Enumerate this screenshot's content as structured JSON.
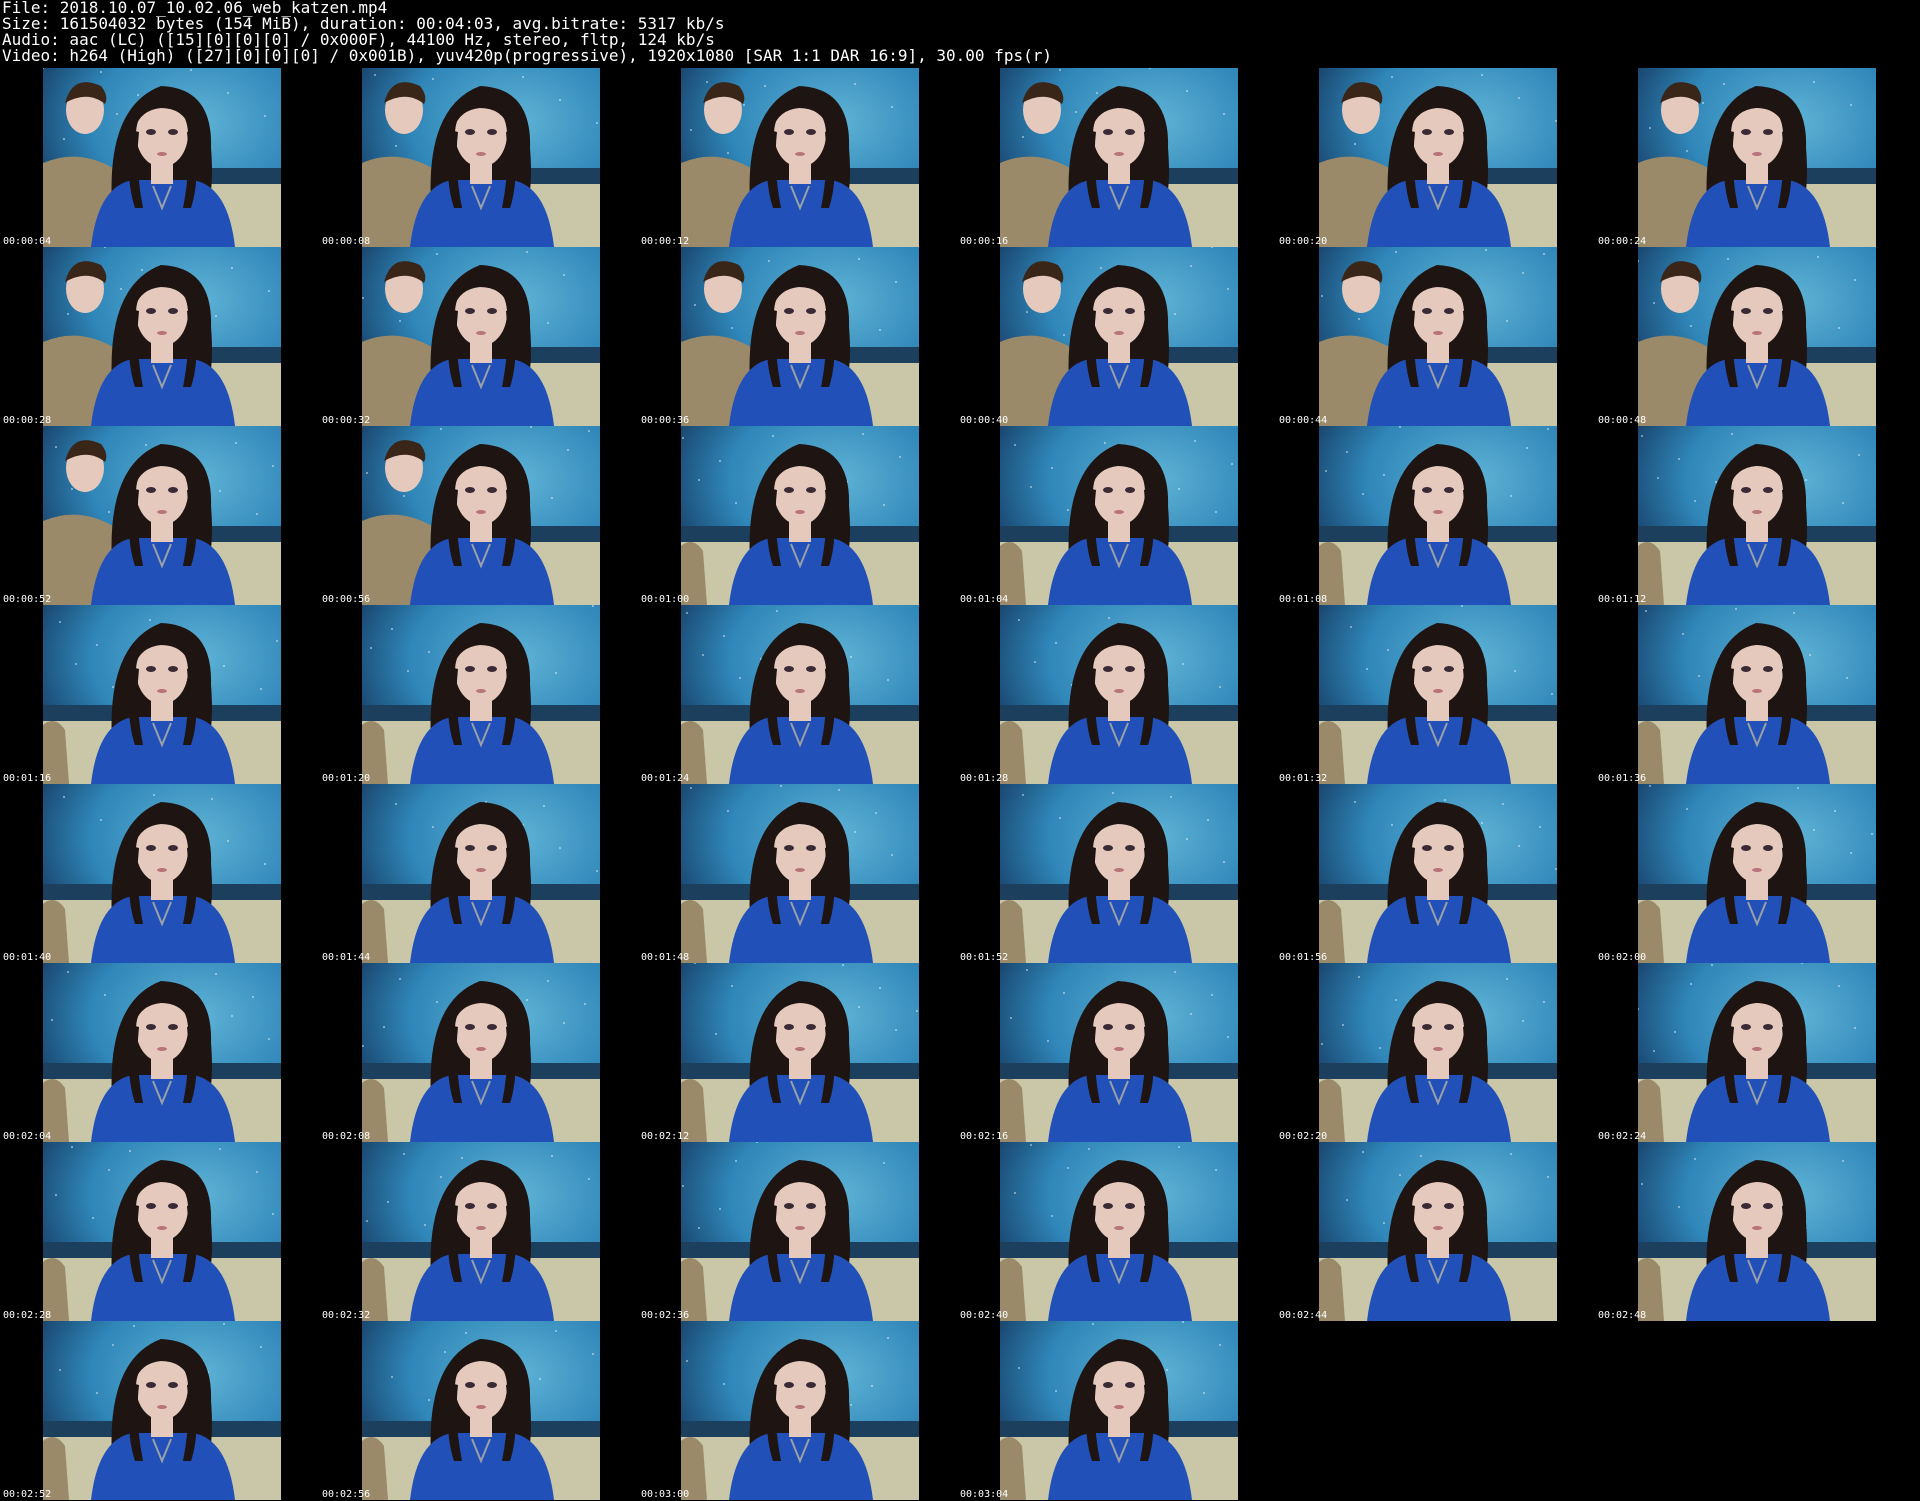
{
  "header": {
    "file_line": "File: 2018.10.07_10.02.06_web_katzen.mp4",
    "size_line": "Size: 161504032 bytes (154 MiB), duration: 00:04:03, avg.bitrate: 5317 kb/s",
    "audio_line": "Audio: aac (LC) ([15][0][0][0] / 0x000F), 44100 Hz, stereo, fltp, 124 kb/s",
    "video_line": "Video: h264 (High) ([27][0][0][0] / 0x001B), yuv420p(progressive), 1920x1080 [SAR 1:1 DAR 16:9], 30.00 fps(r)"
  },
  "colors": {
    "background": "#000000",
    "text": "#ffffff",
    "thumb_sky": "#2f86b8",
    "thumb_sky_light": "#5fb3d6",
    "shirt": "#2050b8",
    "hair": "#1e1412",
    "skin": "#e6c9bd",
    "sofa": "#c9c7a8",
    "hoodie": "#9a8a6a"
  },
  "thumbnails": [
    {
      "time": "00:00:04",
      "companion": true
    },
    {
      "time": "00:00:08",
      "companion": true
    },
    {
      "time": "00:00:12",
      "companion": true
    },
    {
      "time": "00:00:16",
      "companion": true
    },
    {
      "time": "00:00:20",
      "companion": true
    },
    {
      "time": "00:00:24",
      "companion": true
    },
    {
      "time": "00:00:28",
      "companion": true
    },
    {
      "time": "00:00:32",
      "companion": true
    },
    {
      "time": "00:00:36",
      "companion": true
    },
    {
      "time": "00:00:40",
      "companion": true
    },
    {
      "time": "00:00:44",
      "companion": true
    },
    {
      "time": "00:00:48",
      "companion": true
    },
    {
      "time": "00:00:52",
      "companion": true
    },
    {
      "time": "00:00:56",
      "companion": true
    },
    {
      "time": "00:01:00",
      "companion": false
    },
    {
      "time": "00:01:04",
      "companion": false
    },
    {
      "time": "00:01:08",
      "companion": false
    },
    {
      "time": "00:01:12",
      "companion": false
    },
    {
      "time": "00:01:16",
      "companion": false
    },
    {
      "time": "00:01:20",
      "companion": false
    },
    {
      "time": "00:01:24",
      "companion": false
    },
    {
      "time": "00:01:28",
      "companion": false
    },
    {
      "time": "00:01:32",
      "companion": false
    },
    {
      "time": "00:01:36",
      "companion": false
    },
    {
      "time": "00:01:40",
      "companion": false
    },
    {
      "time": "00:01:44",
      "companion": false
    },
    {
      "time": "00:01:48",
      "companion": false
    },
    {
      "time": "00:01:52",
      "companion": false
    },
    {
      "time": "00:01:56",
      "companion": false
    },
    {
      "time": "00:02:00",
      "companion": false
    },
    {
      "time": "00:02:04",
      "companion": false
    },
    {
      "time": "00:02:08",
      "companion": false
    },
    {
      "time": "00:02:12",
      "companion": false
    },
    {
      "time": "00:02:16",
      "companion": false
    },
    {
      "time": "00:02:20",
      "companion": false
    },
    {
      "time": "00:02:24",
      "companion": false
    },
    {
      "time": "00:02:28",
      "companion": false
    },
    {
      "time": "00:02:32",
      "companion": false
    },
    {
      "time": "00:02:36",
      "companion": false
    },
    {
      "time": "00:02:40",
      "companion": false
    },
    {
      "time": "00:02:44",
      "companion": false
    },
    {
      "time": "00:02:48",
      "companion": false
    },
    {
      "time": "00:02:52",
      "companion": false
    },
    {
      "time": "00:02:56",
      "companion": false
    },
    {
      "time": "00:03:00",
      "companion": false
    },
    {
      "time": "00:03:04",
      "companion": false
    }
  ]
}
